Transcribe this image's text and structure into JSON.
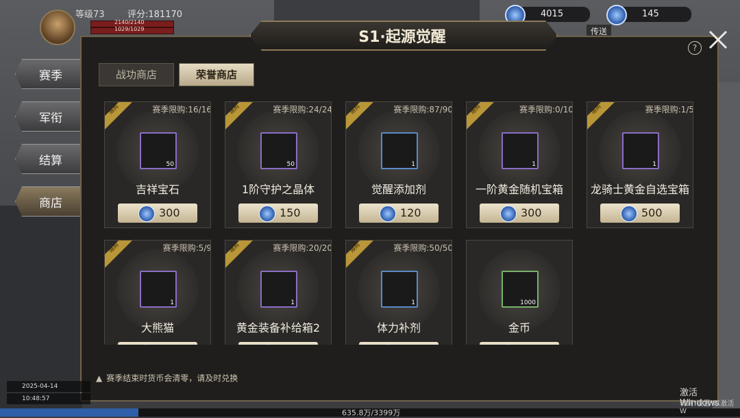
{
  "player": {
    "level": "等级73",
    "score": "评分:181170",
    "hp": "2140/2140",
    "mp": "1029/1029"
  },
  "currency": {
    "diamond": "4015",
    "gem": "145",
    "teleport_label": "传送"
  },
  "left_menu": [
    "赛季",
    "军衔",
    "结算",
    "商店"
  ],
  "panel": {
    "title": "S1·起源觉醒",
    "help_label": "?"
  },
  "tabs": [
    {
      "label": "战功商店",
      "active": false
    },
    {
      "label": "荣誉商店",
      "active": true
    }
  ],
  "ribbon_text": "限购",
  "items": [
    {
      "name": "吉祥宝石",
      "limit": "赛季限购:16/16",
      "count": "50",
      "price": "300",
      "icon": "fire-gem-icon"
    },
    {
      "name": "1阶守护之晶体",
      "limit": "赛季限购:24/24",
      "count": "50",
      "price": "150",
      "icon": "crystal-icon"
    },
    {
      "name": "觉醒添加剂",
      "limit": "赛季限购:87/90",
      "count": "1",
      "price": "120",
      "icon": "awaken-orb-icon"
    },
    {
      "name": "一阶黄金随机宝箱",
      "limit": "赛季限购:0/10",
      "count": "1",
      "price": "300",
      "icon": "mystery-box-icon"
    },
    {
      "name": "龙骑士黄金自选宝箱",
      "limit": "赛季限购:1/5",
      "count": "1",
      "price": "500",
      "icon": "dragon-chest-icon"
    },
    {
      "name": "大熊猫",
      "limit": "赛季限购:5/9",
      "count": "1",
      "price": "",
      "icon": "panda-icon"
    },
    {
      "name": "黄金装备补给箱2",
      "limit": "赛季限购:20/20",
      "count": "1",
      "price": "",
      "icon": "treasure-chest-icon"
    },
    {
      "name": "体力补剂",
      "limit": "赛季限购:50/50",
      "count": "1",
      "price": "",
      "icon": "potion-icon"
    },
    {
      "name": "金币",
      "limit": "",
      "count": "1000",
      "price": "",
      "icon": "gold-coin-icon"
    }
  ],
  "notice": "赛季结束时货币会清零，请及时兑换",
  "footer": {
    "date": "2025-04-14",
    "time": "10:48:57",
    "exp_text": "635.8万/3399万",
    "exp_fraction": 0.187
  },
  "watermark": {
    "line1": "激活 Windows",
    "line2": "转到\"设置\"以激活 W"
  }
}
